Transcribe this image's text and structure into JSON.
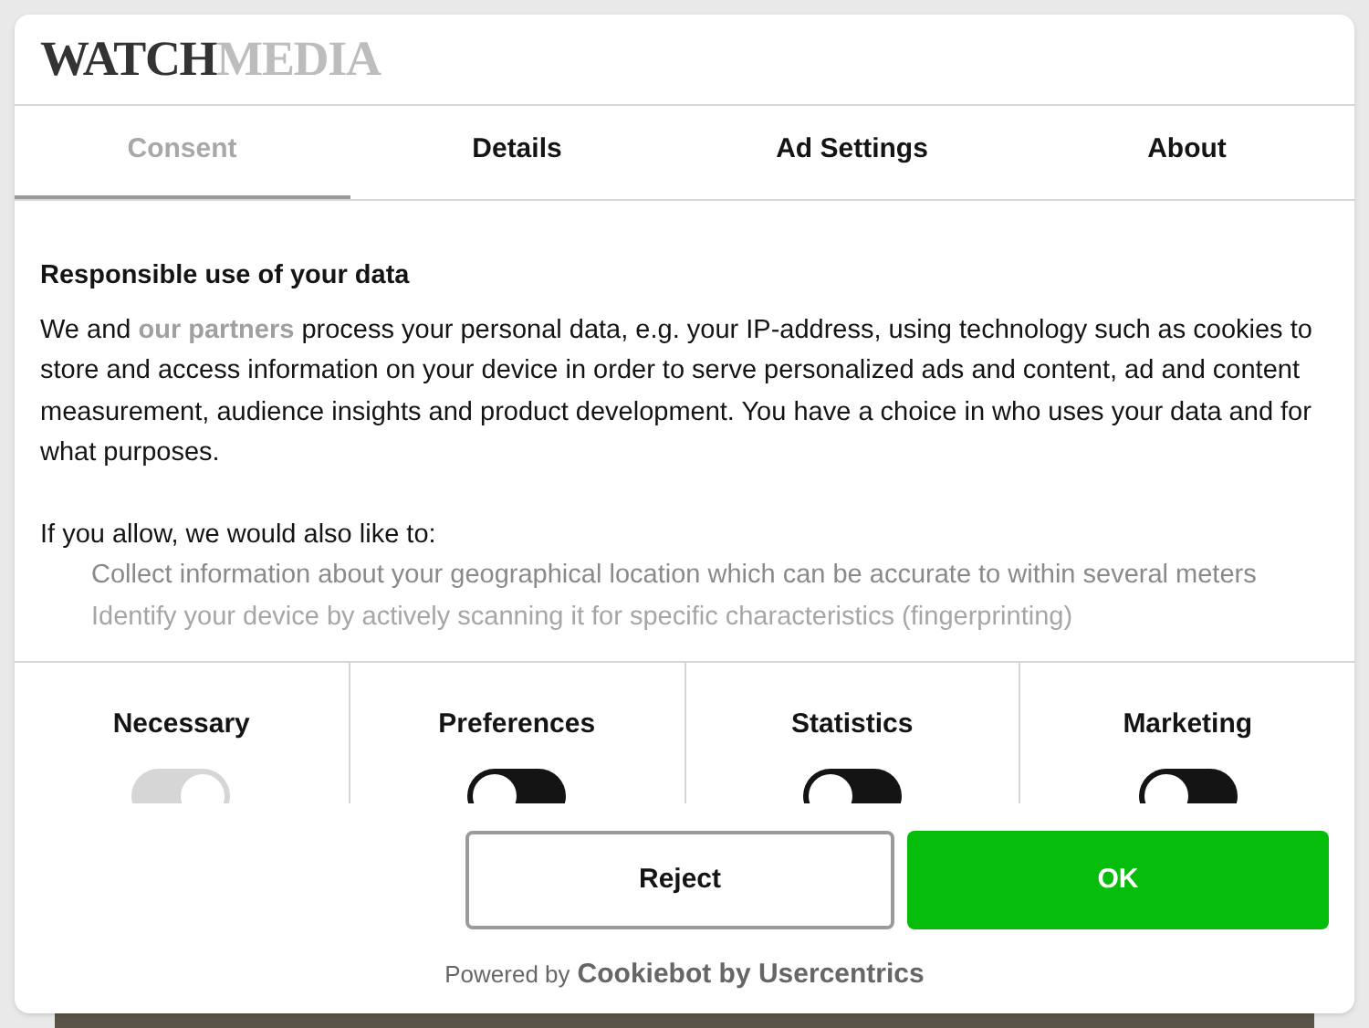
{
  "logo": {
    "part_1": "WATCH",
    "part_2": "MEDIA"
  },
  "tabs": [
    {
      "label": "Consent",
      "selected": true
    },
    {
      "label": "Details",
      "selected": false
    },
    {
      "label": "Ad Settings",
      "selected": false
    },
    {
      "label": "About",
      "selected": false
    }
  ],
  "content": {
    "heading": "Responsible use of your data",
    "intro_before": "We and",
    "intro_link": "our partners",
    "intro_after": "process your personal data, e.g. your IP-address, using technology such as cookies to store and access information on your device in order to serve personalized ads and content, ad and content measurement, audience insights and product development. You have a choice in who uses your data and for what purposes.",
    "allow_text": "If you allow, we would also like to:",
    "purposes": [
      "Collect information about your geographical location which can be accurate to within several meters",
      "Identify your device by actively scanning it for specific characteristics (fingerprinting)"
    ]
  },
  "categories": [
    {
      "label": "Necessary",
      "checked": true,
      "disabled": true
    },
    {
      "label": "Preferences",
      "checked": false,
      "disabled": false
    },
    {
      "label": "Statistics",
      "checked": false,
      "disabled": false
    },
    {
      "label": "Marketing",
      "checked": false,
      "disabled": false
    }
  ],
  "buttons": [
    {
      "label": "Reject",
      "kind": "secondary"
    },
    {
      "label": "OK",
      "kind": "primary"
    }
  ],
  "footer": {
    "prefix": "Powered by",
    "brand": "Cookiebot by Usercentrics"
  }
}
